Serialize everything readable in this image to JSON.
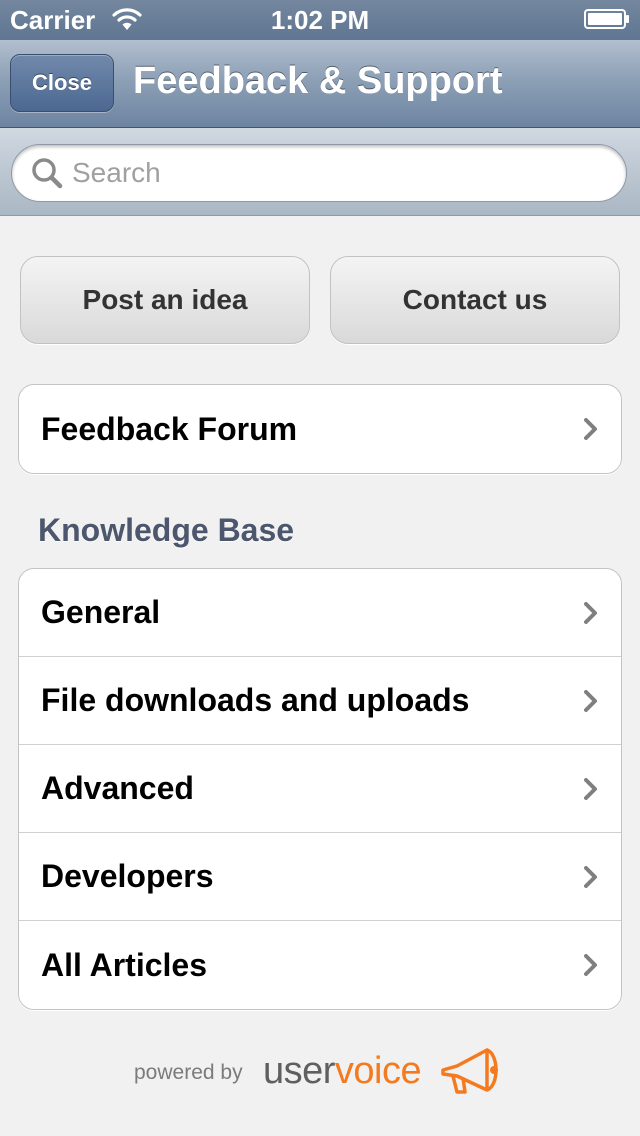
{
  "status_bar": {
    "carrier": "Carrier",
    "time": "1:02 PM"
  },
  "nav": {
    "close_label": "Close",
    "title": "Feedback & Support"
  },
  "search": {
    "placeholder": "Search"
  },
  "actions": {
    "post_idea": "Post an idea",
    "contact_us": "Contact us"
  },
  "forum": {
    "label": "Feedback Forum"
  },
  "knowledge_base": {
    "header": "Knowledge Base",
    "items": [
      {
        "label": "General"
      },
      {
        "label": "File downloads and uploads"
      },
      {
        "label": "Advanced"
      },
      {
        "label": "Developers"
      },
      {
        "label": "All Articles"
      }
    ]
  },
  "footer": {
    "powered_by": "powered by",
    "logo_user": "user",
    "logo_voice": "voice"
  },
  "colors": {
    "nav_blue": "#6d84a1",
    "section_header": "#4c566c",
    "brand_orange": "#f47a20"
  }
}
